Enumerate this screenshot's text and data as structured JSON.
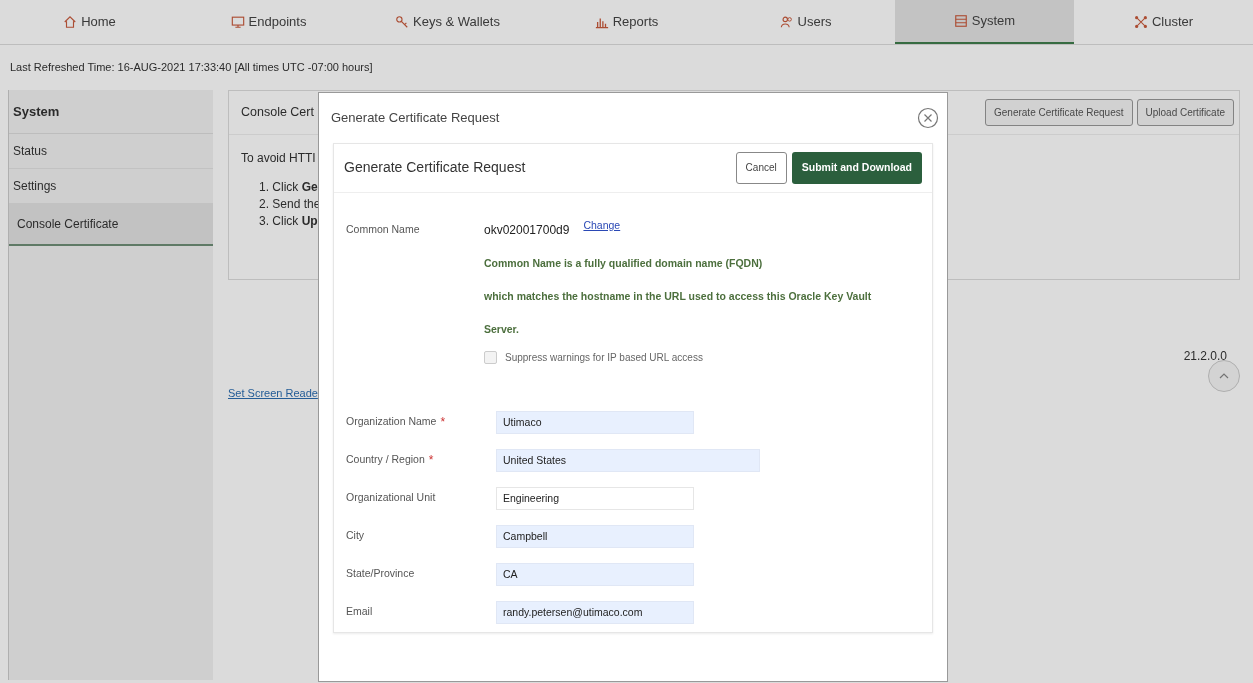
{
  "tabs": [
    {
      "label": "Home",
      "selected": false
    },
    {
      "label": "Endpoints",
      "selected": false
    },
    {
      "label": "Keys & Wallets",
      "selected": false
    },
    {
      "label": "Reports",
      "selected": false
    },
    {
      "label": "Users",
      "selected": false
    },
    {
      "label": "System",
      "selected": true
    },
    {
      "label": "Cluster",
      "selected": false
    }
  ],
  "refreshed": "Last Refreshed Time: 16-AUG-2021 17:33:40 [All times UTC -07:00 hours]",
  "sidebar": {
    "title": "System",
    "items": [
      {
        "label": "Status",
        "selected": false
      },
      {
        "label": "Settings",
        "selected": false
      },
      {
        "label": "Console Certificate",
        "selected": true
      }
    ]
  },
  "panel": {
    "title": "Console Cert",
    "intro": "To avoid HTTI",
    "steps": [
      "1. Click **Ge**",
      "2. Send the",
      "3. Click **Up**"
    ],
    "buttons": [
      "Generate Certificate Request",
      "Upload Certificate"
    ]
  },
  "screen_reader_link": "Set Screen Reade",
  "version": "21.2.0.0",
  "modal": {
    "title": "Generate Certificate Request",
    "card_title": "Generate Certificate Request",
    "cancel": "Cancel",
    "submit": "Submit and Download",
    "common_name": {
      "label": "Common Name",
      "value": "okv02001700d9",
      "link": "Change",
      "help": [
        "Common Name is a fully qualified domain name (FQDN)",
        "which matches the hostname in the URL used to access this Oracle Key Vault",
        "Server."
      ]
    },
    "suppress": {
      "label": "Suppress warnings for IP based URL access",
      "checked": false
    },
    "fields": [
      {
        "label": "Organization Name",
        "required_mark": "*",
        "value": "Utimaco",
        "autofilled": true
      },
      {
        "label": "Country / Region",
        "required_mark": "*",
        "value": "United States",
        "autofilled": true
      },
      {
        "label": "Organizational Unit",
        "value": "Engineering",
        "autofilled": false
      },
      {
        "label": "City",
        "value": "Campbell",
        "autofilled": true
      },
      {
        "label": "State/Province",
        "value": "CA",
        "autofilled": true
      },
      {
        "label": "Email",
        "value": "randy.petersen@utimaco.com",
        "autofilled": true
      }
    ]
  }
}
